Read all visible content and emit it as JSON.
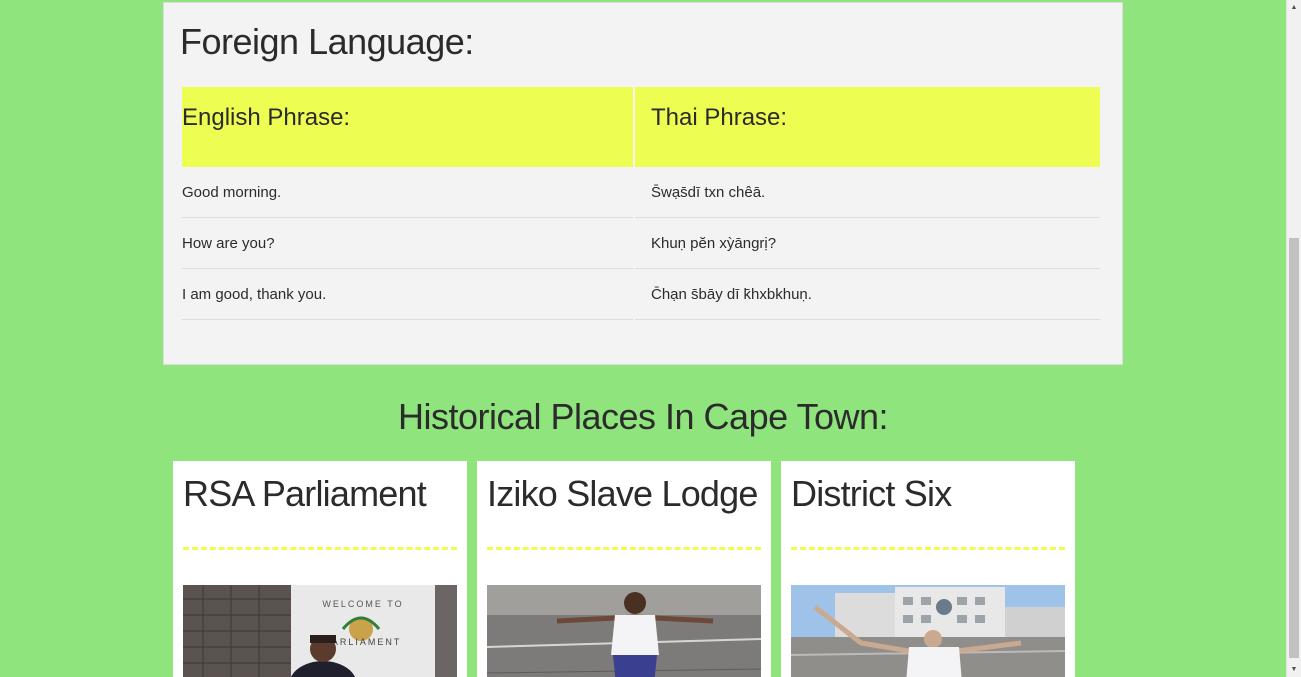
{
  "foreign_language": {
    "title": "Foreign Language:",
    "headers": {
      "english": "English Phrase:",
      "thai": "Thai Phrase:"
    },
    "rows": [
      {
        "english": "Good morning.",
        "thai": "S̄wạs̄dī txn chêā."
      },
      {
        "english": "How are you?",
        "thai": "Khuṇ pĕn xỳāngrị?"
      },
      {
        "english": "I am good, thank you.",
        "thai": "C̄hạn s̄bāy dī k̄hxbkhuṇ."
      }
    ],
    "header_color": "#eefd52"
  },
  "historical_places": {
    "heading": "Historical Places In Cape Town:",
    "cards": [
      {
        "title": "RSA Parliament",
        "photo_icon": "photo-parliament-entrance"
      },
      {
        "title": "Iziko Slave Lodge",
        "photo_icon": "photo-street-pose"
      },
      {
        "title": "District Six",
        "photo_icon": "photo-district-six"
      }
    ]
  },
  "colors": {
    "background": "#90e47d",
    "panel": "#f3f3f3",
    "accent": "#eefd52"
  }
}
